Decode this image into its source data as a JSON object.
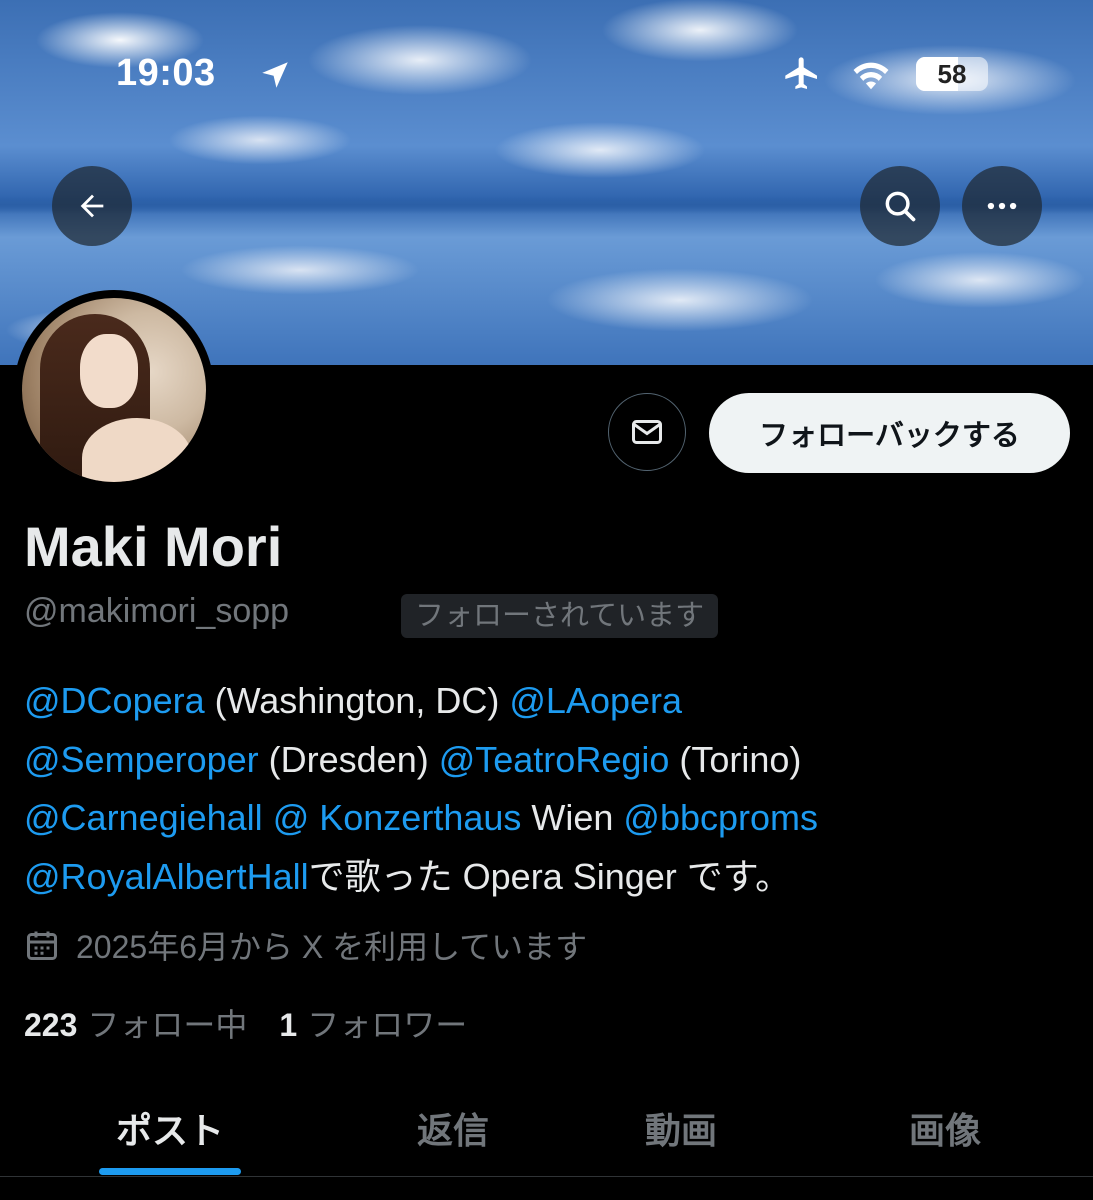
{
  "status_bar": {
    "time": "19:03",
    "battery_percent": "58",
    "battery_level": 0.58,
    "icons": [
      "location-arrow-icon",
      "airplane-icon",
      "wifi-icon",
      "battery-icon"
    ]
  },
  "header_actions": {
    "back_icon": "back-arrow-icon",
    "search_icon": "search-icon",
    "more_icon": "more-dots-icon"
  },
  "profile": {
    "display_name": "Maki Mori",
    "handle": "@makimori_sopp",
    "follows_you_badge": "フォローされています",
    "message_icon": "mail-icon",
    "follow_back_label": "フォローバックする",
    "bio": [
      [
        {
          "text": "@DCopera",
          "mention": true
        },
        {
          "text": " (Washington, DC) ",
          "mention": false
        },
        {
          "text": "@LAopera",
          "mention": true
        }
      ],
      [
        {
          "text": "@Semperoper",
          "mention": true
        },
        {
          "text": " (Dresden) ",
          "mention": false
        },
        {
          "text": "@TeatroRegio",
          "mention": true
        },
        {
          "text": " (Torino)",
          "mention": false
        }
      ],
      [
        {
          "text": "@Carnegiehall",
          "mention": true
        },
        {
          "text": " ",
          "mention": false
        },
        {
          "text": "@ Konzerthaus",
          "mention": true
        },
        {
          "text": " Wien ",
          "mention": false
        },
        {
          "text": "@bbcproms",
          "mention": true
        }
      ],
      [
        {
          "text": "@RoyalAlbertHall",
          "mention": true
        },
        {
          "text": "で歌った Opera Singer です。",
          "mention": false
        }
      ]
    ],
    "joined": "2025年6月から X を利用しています",
    "following_count": "223",
    "following_label": "フォロー中",
    "followers_count": "1",
    "followers_label": "フォロワー"
  },
  "tabs": [
    {
      "label": "ポスト",
      "active": true
    },
    {
      "label": "返信",
      "active": false
    },
    {
      "label": "動画",
      "active": false
    },
    {
      "label": "画像",
      "active": false
    }
  ],
  "colors": {
    "accent": "#1d9bf0",
    "background": "#000000",
    "secondary_text": "#71767b",
    "primary_text": "#e7e9ea"
  }
}
